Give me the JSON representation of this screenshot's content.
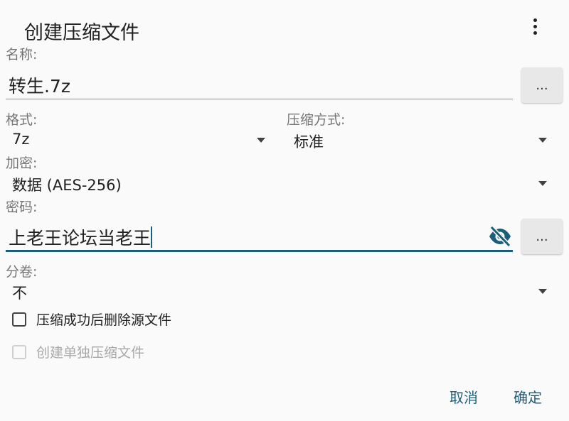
{
  "dialog": {
    "title": "创建压缩文件",
    "menu_icon": "more-vert-icon"
  },
  "name": {
    "label": "名称:",
    "value": "转生.7z",
    "browse_label": "..."
  },
  "format": {
    "label": "格式:",
    "selected": "7z"
  },
  "compression": {
    "label": "压缩方式:",
    "selected": "标准"
  },
  "encryption": {
    "label": "加密:",
    "selected": "数据 (AES-256)"
  },
  "password": {
    "label": "密码:",
    "value": "上老王论坛当老王",
    "visibility_icon": "eye-off-icon",
    "browse_label": "..."
  },
  "split": {
    "label": "分卷:",
    "selected": "不"
  },
  "options": {
    "delete_source_label": "压缩成功后删除源文件",
    "delete_source_checked": false,
    "separate_archives_label": "创建单独压缩文件",
    "separate_archives_checked": false,
    "separate_archives_enabled": false
  },
  "actions": {
    "cancel_label": "取消",
    "ok_label": "确定"
  },
  "colors": {
    "accent": "#1b5e7a",
    "background": "#fafafa"
  }
}
